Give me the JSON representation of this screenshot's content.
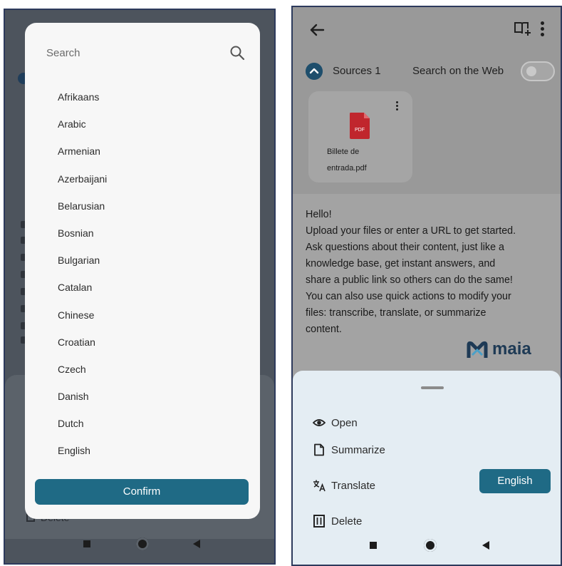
{
  "left_screen": {
    "language_dialog": {
      "search_placeholder": "Search",
      "languages": [
        "Afrikaans",
        "Arabic",
        "Armenian",
        "Azerbaijani",
        "Belarusian",
        "Bosnian",
        "Bulgarian",
        "Catalan",
        "Chinese",
        "Croatian",
        "Czech",
        "Danish",
        "Dutch",
        "English"
      ],
      "confirm_label": "Confirm"
    },
    "background_delete_label": "Delete"
  },
  "right_screen": {
    "sources": {
      "label": "Sources",
      "count": "1",
      "web_search_label": "Search on the Web",
      "web_search_enabled": false
    },
    "file": {
      "type_badge": "PDF",
      "name_line1": "Billete de",
      "name_line2": "entrada.pdf"
    },
    "welcome": {
      "lines": [
        "Hello!",
        "Upload your files or enter a URL to get started.",
        "Ask questions about their content, just like a",
        "knowledge base, get instant answers, and",
        "share a public link so others can do the same!",
        "You can also use quick actions to modify your",
        "files: transcribe, translate, or summarize",
        "content."
      ]
    },
    "brand": "maia",
    "actions": {
      "open": "Open",
      "summarize": "Summarize",
      "translate": "Translate",
      "translate_language": "English",
      "delete": "Delete"
    }
  },
  "colors": {
    "accent": "#1f6a85",
    "brand": "#1e3a55",
    "pdf_red": "#c0262d"
  }
}
